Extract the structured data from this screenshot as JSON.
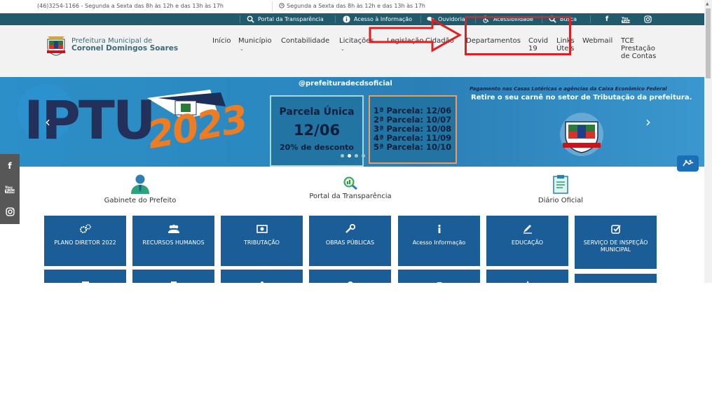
{
  "infobar": {
    "phone": "(46)3254-1166 - Segunda a Sexta das 8h às 12h e das 13h às 17h",
    "hours": "Segunda a Sexta das 8h às 12h e das 13h às 17h"
  },
  "topbar": {
    "links": [
      {
        "label": "Portal da Transparência",
        "icon": "search-icon"
      },
      {
        "label": "Acesso à Informação",
        "icon": "info-icon"
      },
      {
        "label": "Ouvidoria",
        "icon": "chat-icon"
      },
      {
        "label": "Acessibilidade",
        "icon": "wheelchair-icon"
      },
      {
        "label": "Busca",
        "icon": "search-icon"
      }
    ],
    "social": [
      "facebook-icon",
      "youtube-icon",
      "instagram-icon"
    ]
  },
  "header": {
    "logo_line1": "Prefeitura Municipal de",
    "logo_line2": "Coronel Domingos Soares",
    "nav": {
      "inicio": "Início",
      "municipio": "Município",
      "contabilidade": "Contabilidade",
      "licitacoes": "Licitações",
      "legislacao": "Legislação",
      "cidadao": "Cidadão",
      "departamentos": "Departamentos",
      "covid": "Covid 19",
      "links": "Links Úteis",
      "webmail": "Webmail",
      "tce": "TCE Prestação de Contas"
    }
  },
  "banner": {
    "title": "IPTU",
    "year": "2023",
    "handle": "@prefeituradecdsoficial",
    "single_title": "Parcela Única",
    "single_date": "12/06",
    "single_discount": "20% de desconto",
    "installments": [
      "1ª Parcela: 12/06",
      "2ª Parcela: 10/07",
      "3ª Parcela: 10/08",
      "4ª Parcela: 11/09",
      "5ª Parcela: 10/10"
    ],
    "payment_note": "Pagamento nas Casas Lotéricas e agências da Caixa Econômico Federal",
    "pickup_note": "Retire o seu carnê no setor de Tributação da prefeitura."
  },
  "quick_links": {
    "gabinete": "Gabinete do Prefeito",
    "transparencia": "Portal da Transparência",
    "diario": "Diário Oficial"
  },
  "tiles": [
    {
      "label": "PLANO DIRETOR 2022",
      "icon": "gears-icon"
    },
    {
      "label": "RECURSOS HUMANOS",
      "icon": "users-icon"
    },
    {
      "label": "TRIBUTAÇÃO",
      "icon": "money-icon"
    },
    {
      "label": "OBRAS PÚBLICAS",
      "icon": "wrench-icon"
    },
    {
      "label": "Acesso Informação",
      "icon": "info-icon"
    },
    {
      "label": "EDUCAÇÃO",
      "icon": "pencil-icon"
    },
    {
      "label": "SERVIÇO DE INSPEÇÃO MUNICIPAL",
      "icon": "check-square-icon"
    }
  ],
  "colors": {
    "topbar": "#215a6a",
    "tile": "#1b5d96",
    "annotation": "#e02020"
  }
}
